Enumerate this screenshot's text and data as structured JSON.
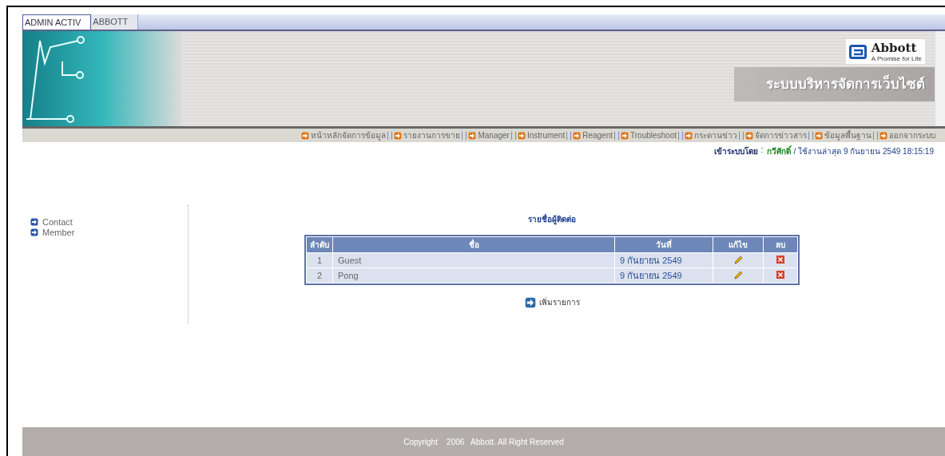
{
  "tabs": [
    {
      "label": "ADMIN ACTIV",
      "selected": true
    },
    {
      "label": "ABBOTT",
      "selected": false
    }
  ],
  "header": {
    "logo_name": "Abbott",
    "logo_tagline": "A Promise for Life",
    "system_title": "ระบบบริหารจัดการเว็บไซต์"
  },
  "menu": [
    {
      "label": "หน้าหลักจัดการข้อมูล"
    },
    {
      "label": "รายงานการขาย"
    },
    {
      "label": "Manager"
    },
    {
      "label": "Instrument"
    },
    {
      "label": "Reagent"
    },
    {
      "label": "Troubleshoot"
    },
    {
      "label": "กระดานข่าว"
    },
    {
      "label": "จัดการข่าวสาร"
    },
    {
      "label": "ข้อมูลพื้นฐาน"
    },
    {
      "label": "ออกจากระบบ"
    }
  ],
  "login": {
    "label": "เข้าระบบโดย",
    "separator": ":",
    "user": "กวีศักดิ์",
    "last_used": "/ ใช้งานล่าสุด 9 กันยายน 2549 18:15:19"
  },
  "sidebar": {
    "items": [
      {
        "label": "Contact"
      },
      {
        "label": "Member"
      }
    ]
  },
  "table": {
    "title": "รายชื่อผู้ติดต่อ",
    "columns": [
      "ลำดับ",
      "ชื่อ",
      "วันที่",
      "แก้ไข",
      "ลบ"
    ],
    "rows": [
      {
        "index": "1",
        "name": "Guest",
        "date": "9 กันยายน 2549"
      },
      {
        "index": "2",
        "name": "Pong",
        "date": "9 กันยายน 2549"
      }
    ]
  },
  "add_link": "เพิ่มรายการ",
  "footer": "Copyright    2006   Abbott. All Right Reserved"
}
